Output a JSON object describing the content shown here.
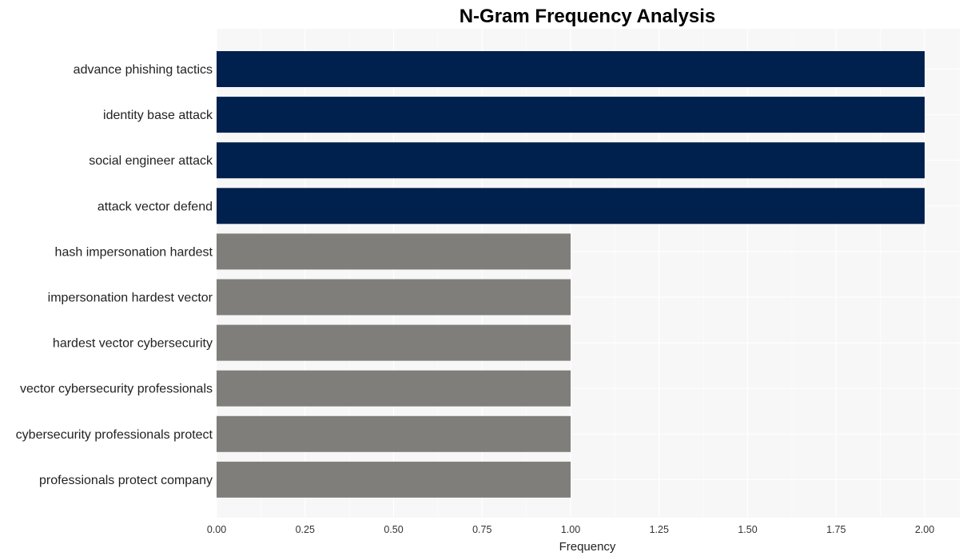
{
  "chart_data": {
    "type": "bar",
    "orientation": "horizontal",
    "title": "N-Gram Frequency Analysis",
    "xlabel": "Frequency",
    "ylabel": "",
    "xlim": [
      0,
      2.1
    ],
    "xticks": [
      "0.00",
      "0.25",
      "0.50",
      "0.75",
      "1.00",
      "1.25",
      "1.50",
      "1.75",
      "2.00"
    ],
    "xtick_values": [
      0,
      0.25,
      0.5,
      0.75,
      1.0,
      1.25,
      1.5,
      1.75,
      2.0
    ],
    "grid": true,
    "categories": [
      "advance phishing tactics",
      "identity base attack",
      "social engineer attack",
      "attack vector defend",
      "hash impersonation hardest",
      "impersonation hardest vector",
      "hardest vector cybersecurity",
      "vector cybersecurity professionals",
      "cybersecurity professionals protect",
      "professionals protect company"
    ],
    "values": [
      2,
      2,
      2,
      2,
      1,
      1,
      1,
      1,
      1,
      1
    ],
    "colors": {
      "high": "#00214d",
      "low": "#7f7e7a",
      "panel_background": "#f7f7f7",
      "grid": "#ffffff"
    }
  }
}
